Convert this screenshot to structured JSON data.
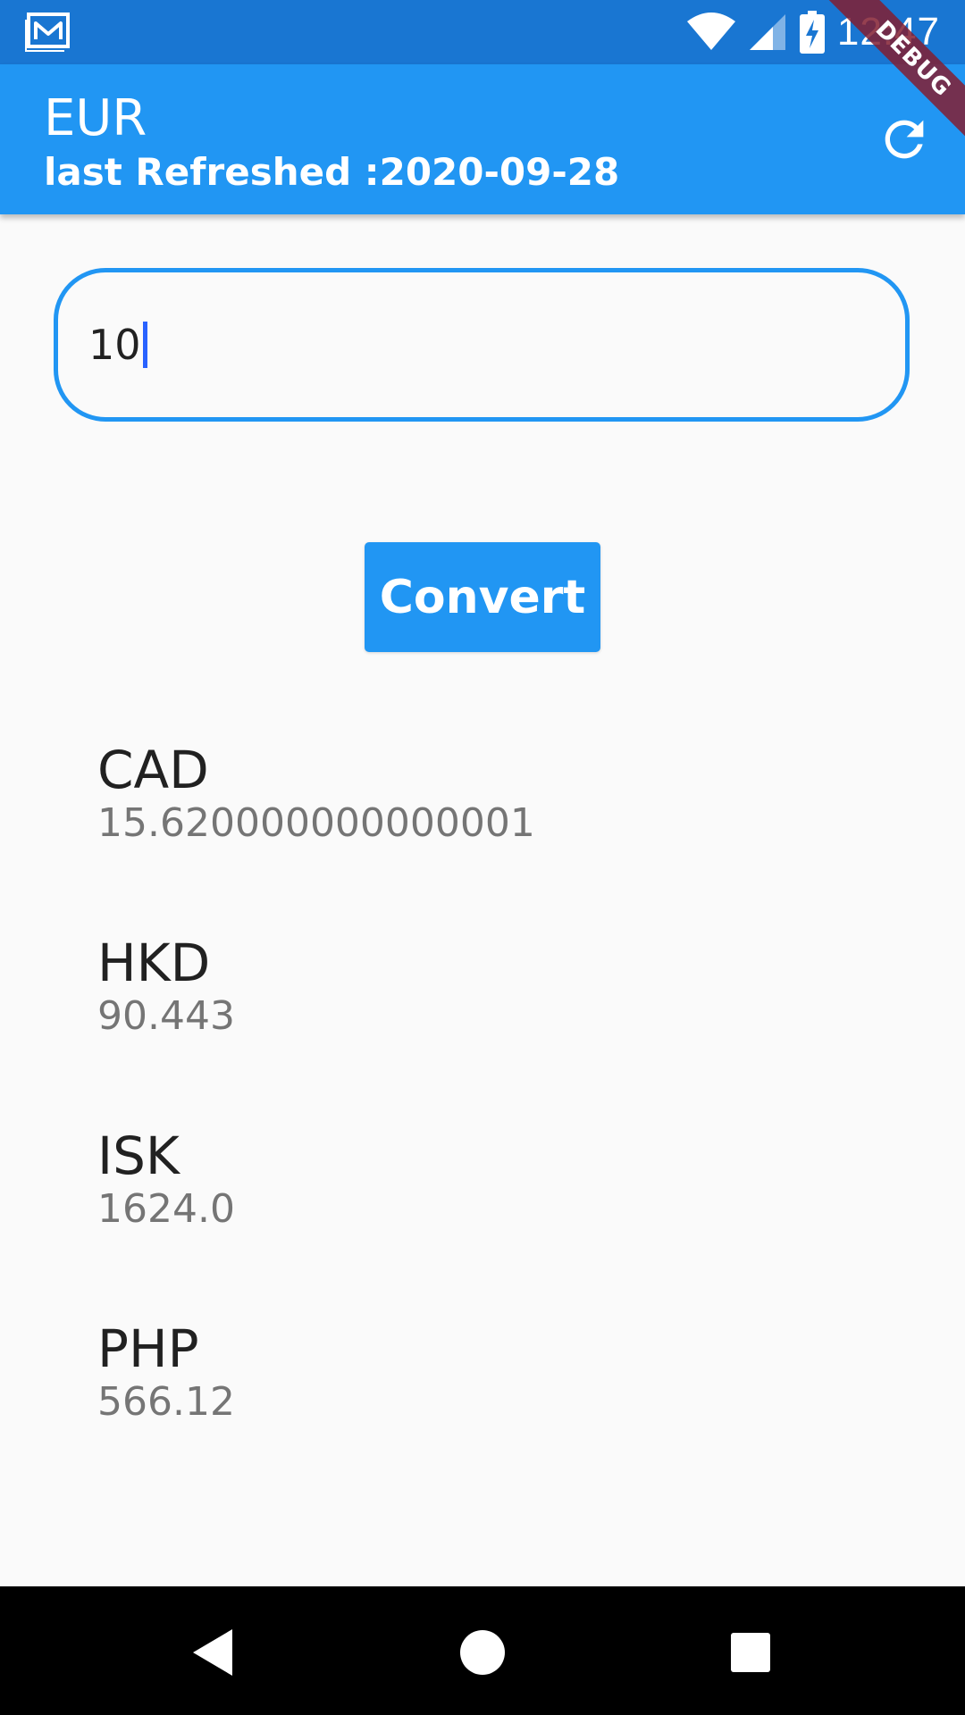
{
  "status_bar": {
    "time": "12:47",
    "left_icon": "gallery-icon",
    "right_icons": [
      "wifi-icon",
      "cell-signal-icon",
      "battery-charging-icon"
    ]
  },
  "debug_banner": "DEBUG",
  "app_bar": {
    "title": "EUR",
    "subtitle": "last Refreshed :2020-09-28",
    "refresh_icon": "refresh-icon"
  },
  "amount_input": {
    "value": "10"
  },
  "convert_button": {
    "label": "Convert"
  },
  "results": [
    {
      "code": "CAD",
      "value": "15.620000000000001"
    },
    {
      "code": "HKD",
      "value": "90.443"
    },
    {
      "code": "ISK",
      "value": "1624.0"
    },
    {
      "code": "PHP",
      "value": "566.12"
    }
  ],
  "nav_bar": {
    "back_icon": "back-icon",
    "home_icon": "home-icon",
    "recents_icon": "recents-icon"
  },
  "colors": {
    "primary": "#2196f3",
    "status_bar": "#1976d2",
    "background": "#fafafa",
    "primary_text": "#212121",
    "secondary_text": "#757575",
    "debug_banner": "#831e31"
  }
}
